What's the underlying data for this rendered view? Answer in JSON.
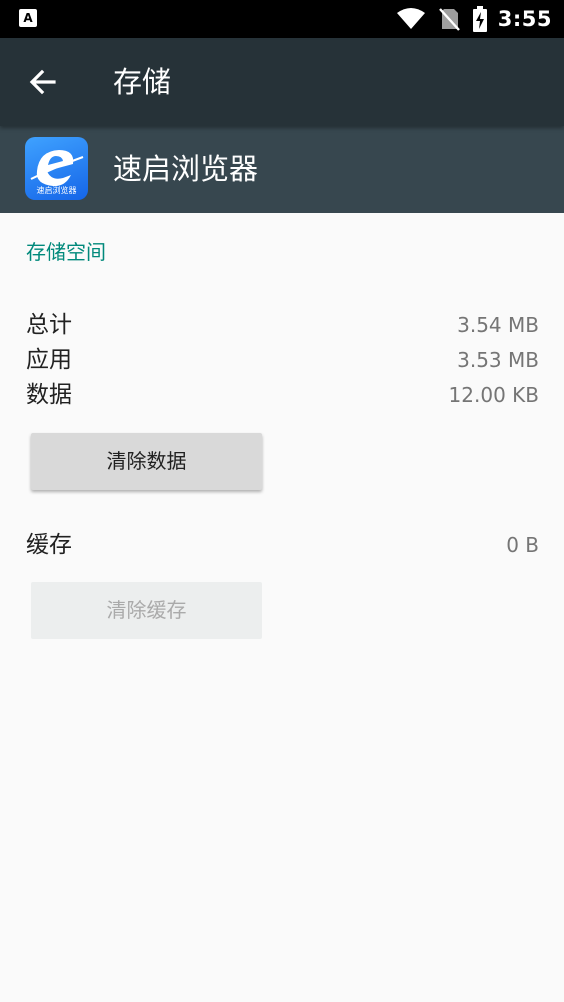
{
  "status_bar": {
    "notification_icon": "A",
    "time": "3:55",
    "icons": [
      "wifi-icon",
      "no-sim-icon",
      "battery-charging-icon"
    ]
  },
  "toolbar": {
    "title": "存储",
    "back_icon": "arrow-left-icon"
  },
  "app": {
    "name": "速启浏览器",
    "icon_caption": "速启浏览器",
    "icon_color": "#1e7bf0"
  },
  "storage": {
    "section_title": "存储空间",
    "rows": [
      {
        "label": "总计",
        "value": "3.54 MB"
      },
      {
        "label": "应用",
        "value": "3.53 MB"
      },
      {
        "label": "数据",
        "value": "12.00 KB"
      }
    ],
    "clear_data_label": "清除数据",
    "cache": {
      "label": "缓存",
      "value": "0 B"
    },
    "clear_cache_label": "清除缓存"
  },
  "colors": {
    "toolbar": "#263238",
    "app_header": "#37474f",
    "accent": "#00897b",
    "background": "#fafafa"
  }
}
